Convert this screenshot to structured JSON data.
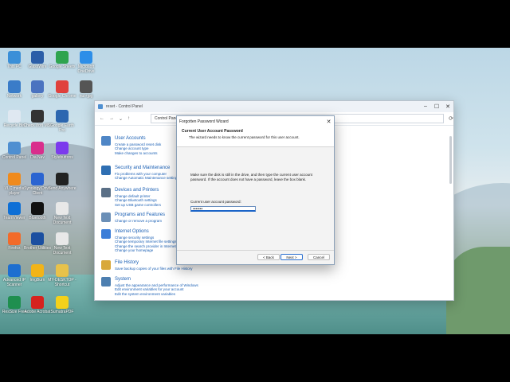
{
  "desktop_icons": [
    {
      "label": "This PC",
      "color": "#3a8fd8"
    },
    {
      "label": "GlassWire",
      "color": "#2b5ea8"
    },
    {
      "label": "Google Sheets",
      "color": "#2ea44f"
    },
    {
      "label": "Microsoft OneDrive",
      "color": "#2d8ee8"
    },
    {
      "label": "Network",
      "color": "#3a7cc8"
    },
    {
      "label": "gallery",
      "color": "#4a73c0"
    },
    {
      "label": "Google Chrome",
      "color": "#e0413c"
    },
    {
      "label": "nut+jpg",
      "color": "#555"
    },
    {
      "label": "Recycle Bin",
      "color": "#dfe8f1"
    },
    {
      "label": "Check (for) MSI",
      "color": "#333"
    },
    {
      "label": "Google Earth Pro",
      "color": "#2d67b0"
    },
    {
      "label": "Control Panel",
      "color": "#4f8fd1"
    },
    {
      "label": "Dia.Nav",
      "color": "#d92e8c"
    },
    {
      "label": "Stylebuttons",
      "color": "#7c3aed"
    },
    {
      "label": "VLC media player",
      "color": "#f08a1c"
    },
    {
      "label": "Synology Drive Client",
      "color": "#2b64d1"
    },
    {
      "label": "Send Anywhere",
      "color": "#222"
    },
    {
      "label": "TeamViewer",
      "color": "#0e6fd6"
    },
    {
      "label": "Bluetooth",
      "color": "#111"
    },
    {
      "label": "New Text Document",
      "color": "#e8e8e8"
    },
    {
      "label": "Firefox",
      "color": "#f26b2a"
    },
    {
      "label": "Brother Utilities",
      "color": "#1b4fa0"
    },
    {
      "label": "New Text Document",
      "color": "#e8e8e8"
    },
    {
      "label": "Advanced IP Scanner",
      "color": "#1e6fd0"
    },
    {
      "label": "ImgBurn",
      "color": "#f2b418"
    },
    {
      "label": "MY-DESKTOP - Shortcut",
      "color": "#e8c24a"
    },
    {
      "label": "ResSize Free",
      "color": "#1f8f4f"
    },
    {
      "label": "Adobe Acrobat",
      "color": "#d6231f"
    },
    {
      "label": "SumatraPDF",
      "color": "#f3d11a"
    }
  ],
  "cp_window": {
    "title": "reset - Control Panel",
    "address": "Control Panel",
    "categories": [
      {
        "title": "User Accounts",
        "color": "#4f86c6",
        "links": [
          "Create a password reset disk",
          "Change account type",
          "Make changes to accounts"
        ]
      },
      {
        "title": "Security and Maintenance",
        "color": "#2f6fb3",
        "links": [
          "Fix problems with your computer",
          "Change Automatic Maintenance settings"
        ]
      },
      {
        "title": "Devices and Printers",
        "color": "#5a6f86",
        "links": [
          "Change default printer",
          "Change Bluetooth settings",
          "Set up USB game controllers"
        ]
      },
      {
        "title": "Programs and Features",
        "color": "#6b8fb7",
        "links": [
          "Change or remove a program"
        ]
      },
      {
        "title": "Internet Options",
        "color": "#3b7dd8",
        "links": [
          "Change security settings",
          "Change temporary Internet file settings",
          "Change the search provider in Internet Explorer",
          "Change your homepage"
        ]
      },
      {
        "title": "File History",
        "color": "#d8a83a",
        "links": [
          "Save backup copies of your files with File History"
        ]
      },
      {
        "title": "System",
        "color": "#4d7fb0",
        "links": [
          "Adjust the appearance and performance of Windows",
          "Edit environment variables for your account",
          "Edit the system environment variables"
        ]
      }
    ]
  },
  "dialog": {
    "title": "Forgotten Password Wizard",
    "heading": "Current User Account Password",
    "subheading": "The wizard needs to know the current password for this user account.",
    "message": "Make sure the disk is still in the drive, and then type the current user account password. If the account does not have a password, leave the box blank.",
    "password_label": "Current user account password:",
    "password_value": "•••••••",
    "back_label": "< Back",
    "next_label": "Next >",
    "cancel_label": "Cancel"
  }
}
